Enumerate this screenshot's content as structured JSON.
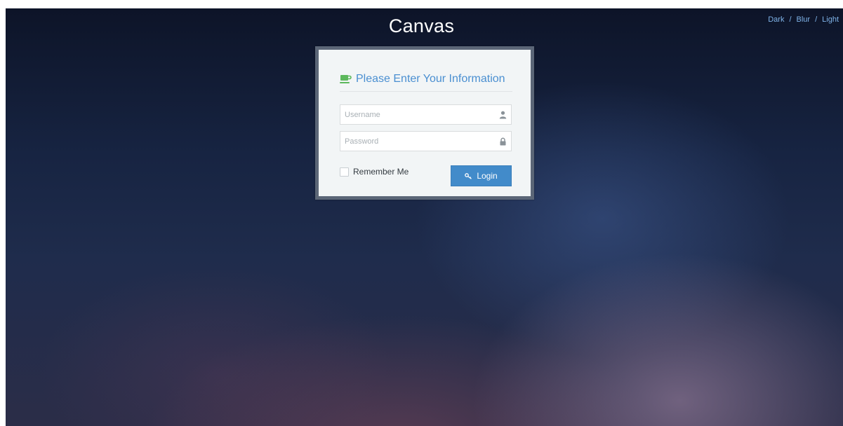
{
  "app": {
    "title": "Canvas"
  },
  "theme_switch": {
    "options": [
      "Dark",
      "Blur",
      "Light"
    ],
    "separator": "/"
  },
  "login_form": {
    "header": {
      "title": "Please Enter Your Information",
      "icon": "coffee-cup-icon"
    },
    "username": {
      "placeholder": "Username",
      "value": "",
      "icon": "user-icon"
    },
    "password": {
      "placeholder": "Password",
      "value": "",
      "icon": "lock-icon"
    },
    "remember_me": {
      "label": "Remember Me",
      "checked": false
    },
    "submit": {
      "label": "Login",
      "icon": "key-icon"
    }
  },
  "colors": {
    "accent": "#428bca",
    "header_text": "#4a8fd1",
    "cup_icon": "#5cb85c",
    "card_border": "#5b6677",
    "link": "#7fb3e8"
  }
}
